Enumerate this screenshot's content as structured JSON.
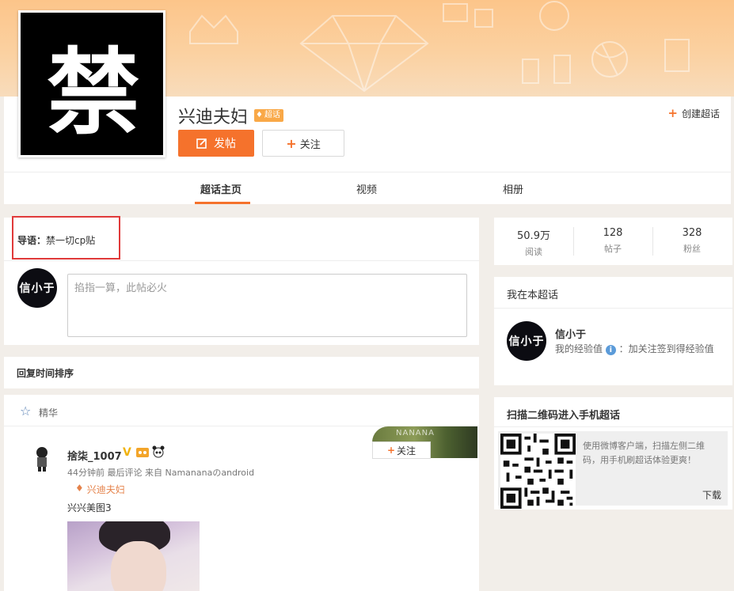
{
  "topic": {
    "avatar_char": "禁",
    "title": "兴迪夫妇",
    "badge": "超话",
    "post_button": "发帖",
    "follow_button": "关注",
    "create_link": "创建超话"
  },
  "tabs": [
    {
      "label": "超话主页",
      "active": true
    },
    {
      "label": "视频",
      "active": false
    },
    {
      "label": "相册",
      "active": false
    }
  ],
  "guide": {
    "label": "导语：",
    "text": "禁一切cp贴",
    "user_avatar_text": "信小于",
    "compose_placeholder": "掐指一算，此帖必火"
  },
  "sort": {
    "label": "回复时间排序"
  },
  "feed": {
    "section_label": "精华",
    "post": {
      "author": "捨柒_1007",
      "verified_mark": "V",
      "meta": "44分钟前 最后评论 来自 Namananaのandroid",
      "topic_tag": "兴迪夫妇",
      "text": "兴兴美图3",
      "card_caption": "NANANA",
      "follow_label": "关注"
    }
  },
  "stats": [
    {
      "num": "50.9万",
      "label": "阅读"
    },
    {
      "num": "128",
      "label": "帖子"
    },
    {
      "num": "328",
      "label": "粉丝"
    }
  ],
  "me": {
    "title": "我在本超话",
    "avatar_text": "信小于",
    "name": "信小于",
    "exp_label": "我的经验值",
    "exp_tip": "：加关注签到得经验值"
  },
  "qr": {
    "title": "扫描二维码进入手机超话",
    "text": "使用微博客户端，扫描左侧二维码，用手机刷超话体验更爽！",
    "download": "下载"
  },
  "colors": {
    "accent": "#f5722c",
    "banner": "#fcc58a",
    "highlight_box": "#e03a3a"
  }
}
